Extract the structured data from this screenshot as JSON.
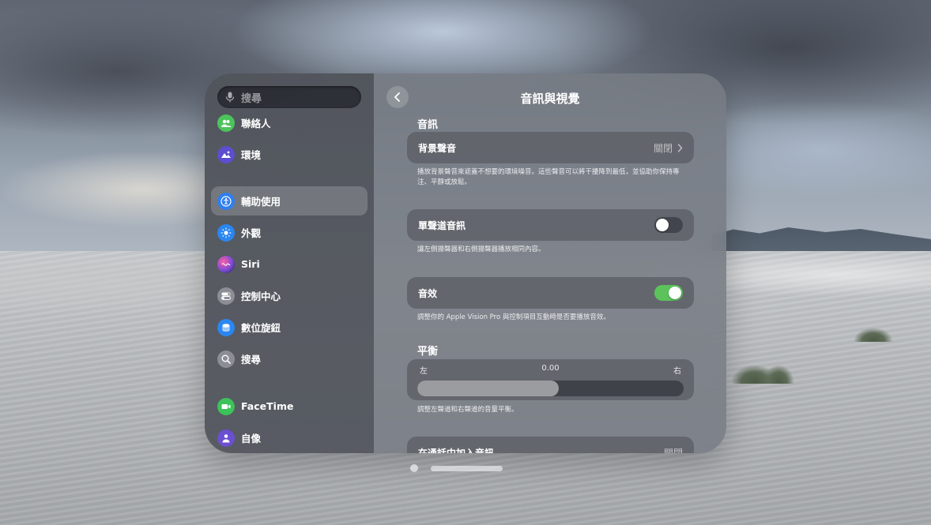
{
  "sidebar": {
    "search_placeholder": "搜尋",
    "items": [
      {
        "label": "聯絡人",
        "icon": "contacts-icon",
        "color": "#4cc45c"
      },
      {
        "label": "環境",
        "icon": "environments-icon",
        "color": "#5b4fcf"
      },
      {
        "label": "輔助使用",
        "icon": "accessibility-icon",
        "color": "#2f7ff0",
        "active": true
      },
      {
        "label": "外觀",
        "icon": "appearance-icon",
        "color": "#2a86f2"
      },
      {
        "label": "Siri",
        "icon": "siri-icon",
        "color": "#7a4bd6"
      },
      {
        "label": "控制中心",
        "icon": "control-center-icon",
        "color": "#8b8e94"
      },
      {
        "label": "數位旋鈕",
        "icon": "digital-crown-icon",
        "color": "#2a86f2"
      },
      {
        "label": "搜尋",
        "icon": "search-icon",
        "color": "#8b8e94"
      },
      {
        "label": "FaceTime",
        "icon": "facetime-icon",
        "color": "#3dc25a"
      },
      {
        "label": "自像",
        "icon": "persona-icon",
        "color": "#6a4fd1"
      }
    ]
  },
  "main": {
    "title": "音訊與視覺",
    "audio_section": "音訊",
    "background_sounds": {
      "label": "背景聲音",
      "value": "關閉"
    },
    "background_sounds_note": "播放背景聲音來遮蓋不想要的環境噪音。這些聲音可以將干擾降到最低，並協助你保持專注、平靜或放鬆。",
    "mono_audio": {
      "label": "單聲道音訊",
      "on": false
    },
    "mono_audio_note": "讓左側揚聲器和右側揚聲器播放相同內容。",
    "sound_effects": {
      "label": "音效",
      "on": true
    },
    "sound_effects_note": "調整你的 Apple Vision Pro 與控制項目互動時是否要播放音效。",
    "balance_section": "平衡",
    "balance": {
      "left": "左",
      "right": "右",
      "value": "0.00",
      "level": 0.53
    },
    "balance_note": "調整左聲道和右聲道的音量平衡。",
    "next_row": {
      "label": "在通話中加入音訊",
      "value": "關閉"
    }
  },
  "colors": {
    "toggle_on": "#5cc35c"
  }
}
